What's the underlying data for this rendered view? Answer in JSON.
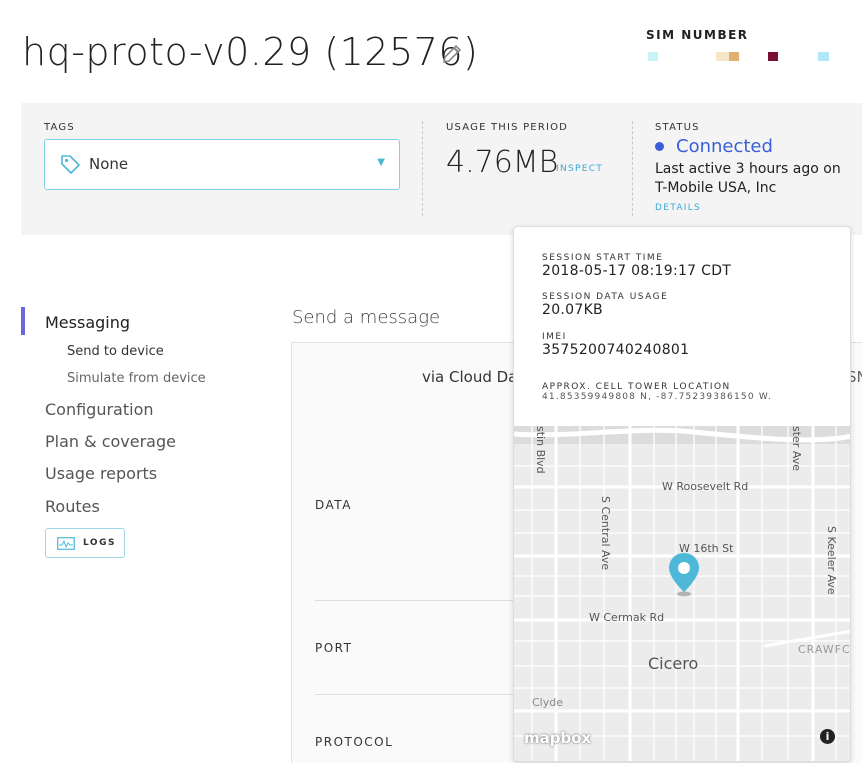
{
  "header": {
    "title": "hq-proto-v0.29 (12576)",
    "edit_icon": "pencil-icon",
    "sim_label": "SIM NUMBER",
    "sim_colors": [
      "#c9f4f7",
      "#f5e6c8",
      "#e0b070",
      "#7a1030",
      "#b0e8f7"
    ]
  },
  "info": {
    "tags_label": "TAGS",
    "tags_value": "None",
    "tag_icon": "tag-icon",
    "usage_label": "USAGE THIS PERIOD",
    "usage_value": "4.76MB",
    "inspect_label": "INSPECT",
    "status_label": "STATUS",
    "status_value": "Connected",
    "last_active": "Last active 3 hours ago on T-Mobile USA, Inc",
    "details_label": "DETAILS",
    "status_color": "#3a5fd9",
    "accent_color": "#3aa9d6"
  },
  "sidebar": {
    "items": [
      {
        "label": "Messaging"
      },
      {
        "label": "Send to device"
      },
      {
        "label": "Simulate from device"
      },
      {
        "label": "Configuration"
      },
      {
        "label": "Plan & coverage"
      },
      {
        "label": "Usage reports"
      },
      {
        "label": "Routes"
      }
    ],
    "logs_label": "LOGS",
    "active_color": "#6b68d9"
  },
  "main": {
    "title": "Send a message",
    "via_label": "via Cloud Da",
    "via_right": "SN",
    "rows": [
      "DATA",
      "PORT",
      "PROTOCOL"
    ]
  },
  "popup": {
    "start_label": "SESSION START TIME",
    "start_value": "2018-05-17 08:19:17 CDT",
    "usage_label": "SESSION DATA USAGE",
    "usage_value": "20.07KB",
    "imei_label": "IMEI",
    "imei_value": "3575200740240801",
    "tower_label": "APPROX. CELL TOWER LOCATION",
    "tower_value": "41.85359949808 N, -87.75239386150 W."
  },
  "map": {
    "streets": {
      "roosevelt": "W Roosevelt Rd",
      "sixteenth": "W 16th St",
      "cermak": "W Cermak Rd",
      "central": "S Central Ave",
      "keeler": "S Keeler Ave",
      "austin": "stin Blvd",
      "pulaski": "ster Ave",
      "crawford": "CRAWFC",
      "clyde": "Clyde"
    },
    "city": "Cicero",
    "attribution": "mapbox",
    "info": "i",
    "pin_color": "#4fb8d8"
  }
}
